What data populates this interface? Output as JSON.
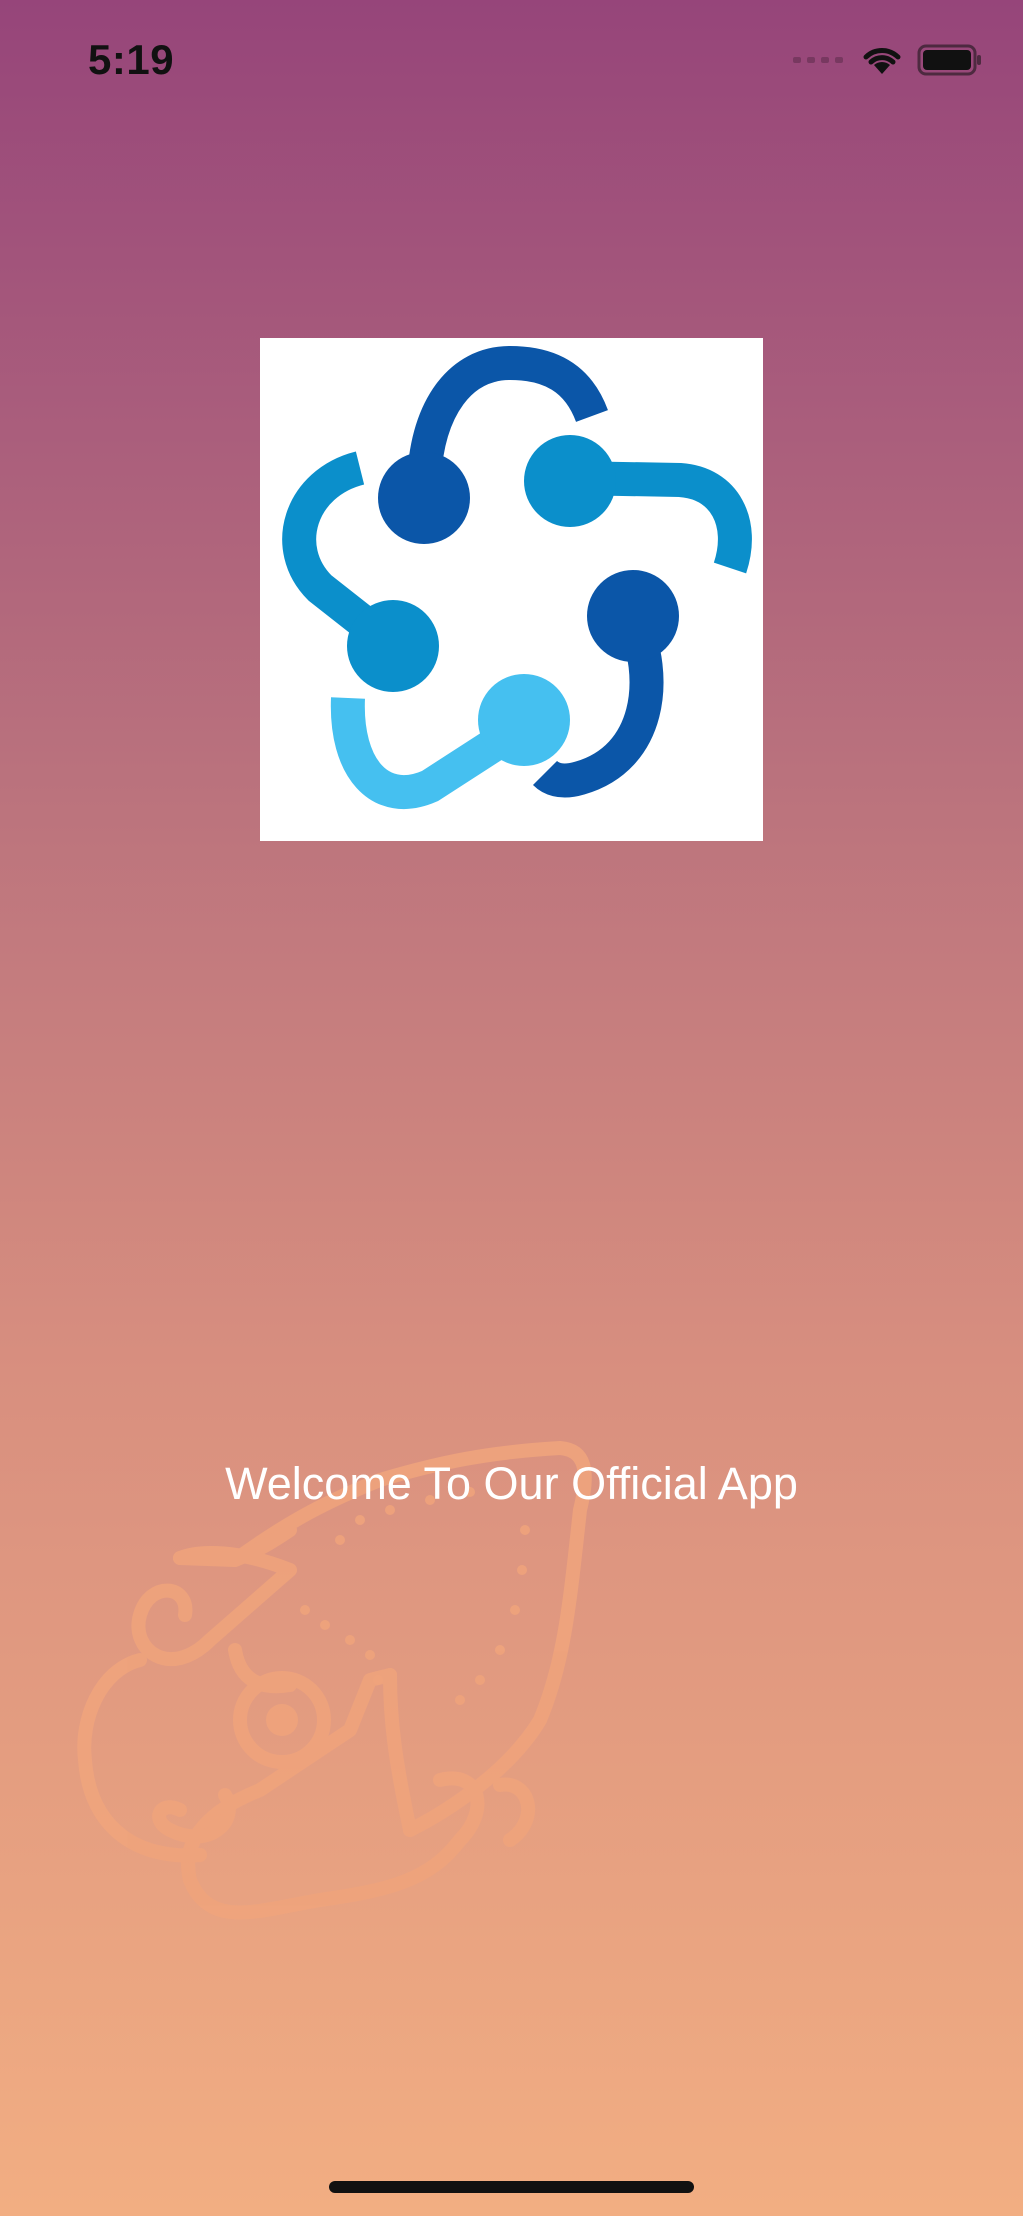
{
  "status_bar": {
    "time": "5:19"
  },
  "welcome": {
    "text": "Welcome To Our Official App"
  },
  "colors": {
    "gradient_top": "#96457a",
    "gradient_bottom": "#f2ae82",
    "logo_dark_blue": "#0b56a8",
    "logo_mid_blue": "#0b8fcb",
    "logo_light_blue": "#45c0f0",
    "decoration": "#f0a47c"
  },
  "icons": {
    "signal": "cellular-signal-icon",
    "wifi": "wifi-icon",
    "battery": "battery-icon",
    "logo": "app-logo",
    "decoration": "squid-decoration-icon"
  }
}
